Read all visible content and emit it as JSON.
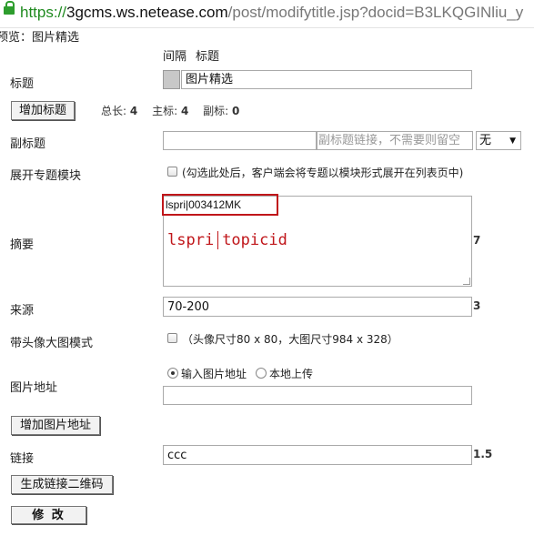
{
  "browser": {
    "url_scheme": "https://",
    "url_host": "3gcms.ws.netease.com",
    "url_path": "/post/modifytitle.jsp?docid=B3LKQGINliu_y"
  },
  "preview": "预览：图片精选",
  "column_headers": {
    "spacing": "间隔",
    "title": "标题"
  },
  "title_row": {
    "label": "标题",
    "value": "图片精选"
  },
  "add_title_button": "增加标题",
  "stats": {
    "total_label": "总长:",
    "total": "4",
    "main_label": "主标:",
    "main": "4",
    "sub_label": "副标:",
    "sub": "0"
  },
  "subtitle_row": {
    "label": "副标题",
    "value": "",
    "link_placeholder": "副标题链接，不需要则留空",
    "select_value": "无"
  },
  "expand_row": {
    "label": "展开专题模块",
    "checkbox_text": "(勾选此处后，客户端会将专题以模块形式展开在列表页中)"
  },
  "summary_row": {
    "label": "摘要",
    "line1": "lspri|003412MK",
    "line2_a": "lspri",
    "line2_b": "topicid",
    "count": "7"
  },
  "source_row": {
    "label": "来源",
    "value": "70-200",
    "count": "3"
  },
  "avatar_row": {
    "label": "带头像大图模式",
    "checkbox_text": "（头像尺寸80 x 80，大图尺寸984 x 328）"
  },
  "image_row": {
    "label": "图片地址",
    "radio_input": "输入图片地址",
    "radio_upload": "本地上传",
    "value": ""
  },
  "add_image_button": "增加图片地址",
  "link_row": {
    "label": "链接",
    "value": "ccc",
    "count": "1.5"
  },
  "qrcode_button": "生成链接二维码",
  "modify_button": "修 改",
  "colors": {
    "highlight_border": "#c0161a",
    "summary_text": "#c0161a",
    "url_green": "#1f8a1f"
  }
}
